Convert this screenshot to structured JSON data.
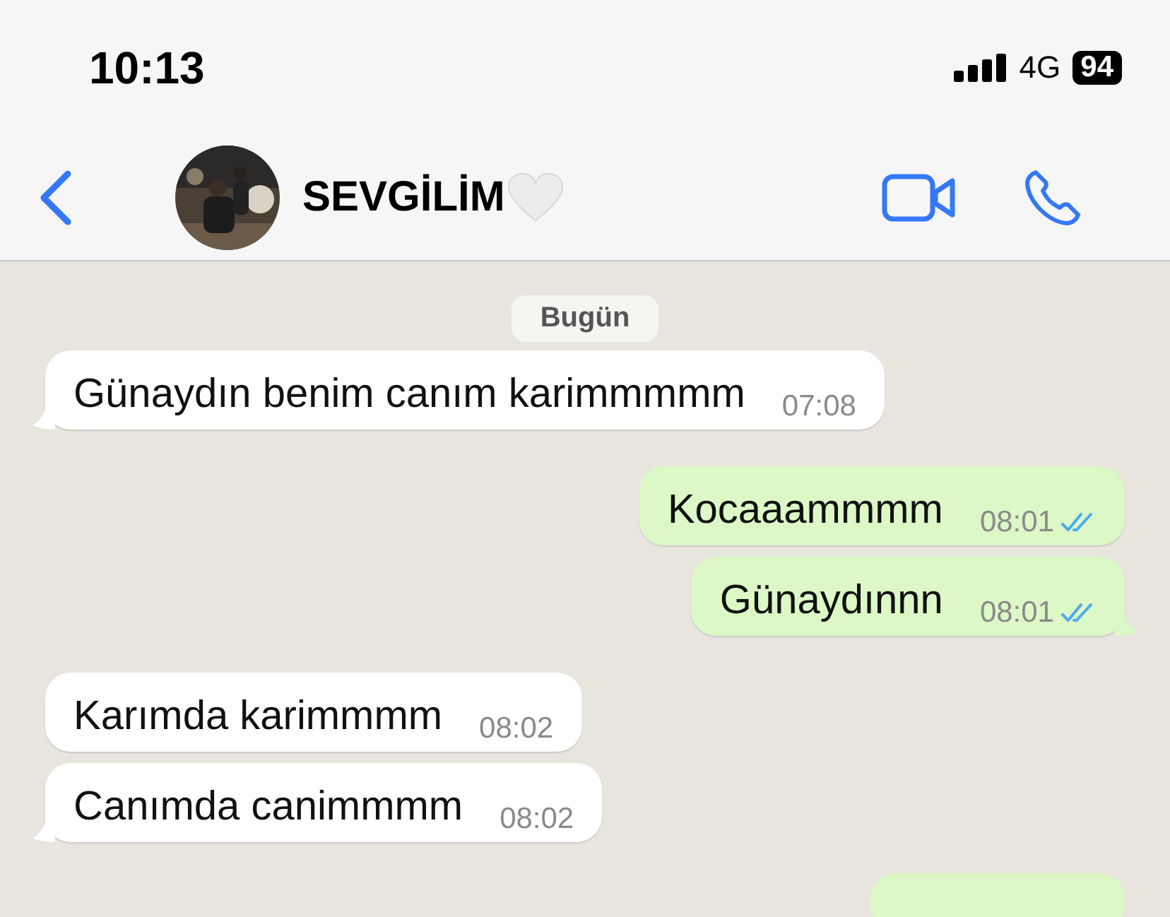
{
  "status_bar": {
    "time": "10:13",
    "network": "4G",
    "battery": "94"
  },
  "header": {
    "contact_name": "SEVGİLİM"
  },
  "date_label": "Bugün",
  "messages": [
    {
      "kind": "incoming",
      "text": "Günaydın benim canım karimmmmm",
      "time": "07:08",
      "tail": true
    },
    {
      "kind": "outgoing",
      "text": "Kocaaammmm",
      "time": "08:01",
      "read": true,
      "tail": false
    },
    {
      "kind": "outgoing",
      "text": "Günaydınnn",
      "time": "08:01",
      "read": true,
      "tail": true
    },
    {
      "kind": "incoming",
      "text": "Karımda karimmmm",
      "time": "08:02",
      "tail": false
    },
    {
      "kind": "incoming",
      "text": "Canımda canimmmm",
      "time": "08:02",
      "tail": true
    }
  ]
}
